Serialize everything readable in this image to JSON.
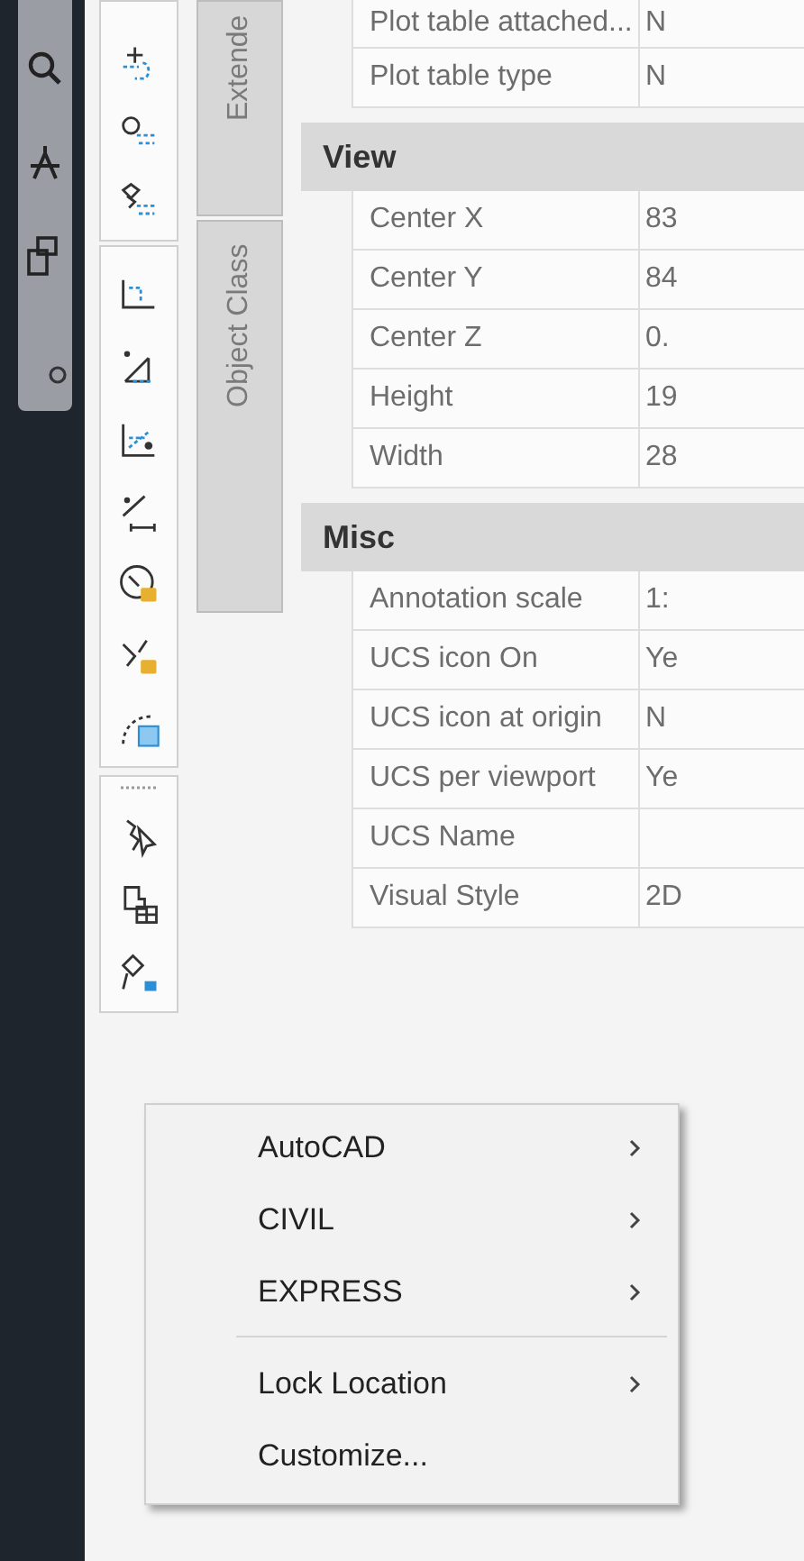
{
  "side_tabs": [
    {
      "label": "Extende",
      "selected": false
    },
    {
      "label": "Object Class",
      "selected": false
    }
  ],
  "property_grid": {
    "sections": [
      {
        "rows": [
          {
            "name": "Plot table attached...",
            "value": "N"
          },
          {
            "name": "Plot table type",
            "value": "N"
          }
        ]
      },
      {
        "title": "View",
        "rows": [
          {
            "name": "Center X",
            "value": "83"
          },
          {
            "name": "Center Y",
            "value": "84"
          },
          {
            "name": "Center Z",
            "value": "0."
          },
          {
            "name": "Height",
            "value": "19"
          },
          {
            "name": "Width",
            "value": "28"
          }
        ]
      },
      {
        "title": "Misc",
        "rows": [
          {
            "name": "Annotation scale",
            "value": "1:"
          },
          {
            "name": "UCS icon On",
            "value": "Ye"
          },
          {
            "name": "UCS icon at origin",
            "value": "N"
          },
          {
            "name": "UCS per viewport",
            "value": "Ye"
          },
          {
            "name": "UCS Name"
          },
          {
            "name": "Visual Style",
            "value": "2D"
          }
        ]
      }
    ]
  },
  "context_menu": {
    "items": [
      {
        "kind": "item",
        "label": "AutoCAD",
        "submenu": true
      },
      {
        "kind": "item",
        "label": "CIVIL",
        "submenu": true
      },
      {
        "kind": "item",
        "label": "EXPRESS",
        "submenu": true
      },
      {
        "kind": "separator"
      },
      {
        "kind": "item",
        "label": "Lock Location",
        "submenu": true
      },
      {
        "kind": "item",
        "label": "Customize...",
        "submenu": false
      }
    ]
  }
}
